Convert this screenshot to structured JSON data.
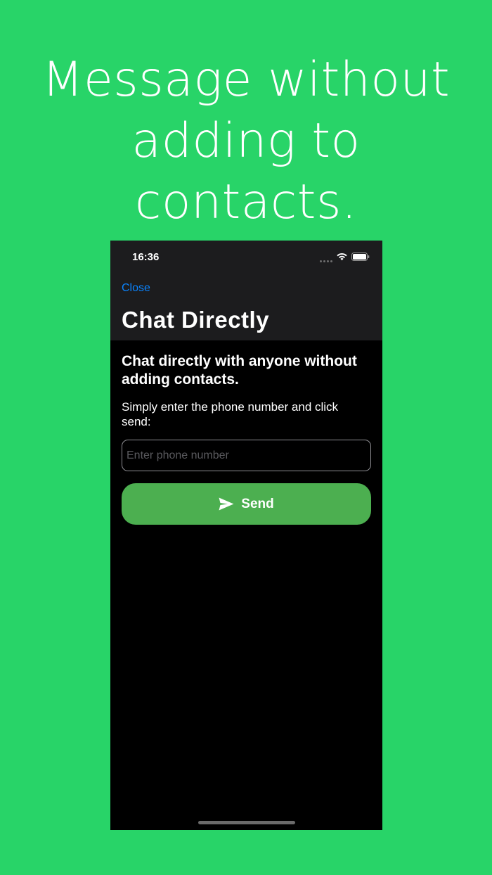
{
  "promo": {
    "headline_lines": [
      "Message without",
      "adding to",
      "contacts."
    ]
  },
  "status_bar": {
    "time": "16:36",
    "icons": [
      "cellular-dots-icon",
      "wifi-icon",
      "battery-icon"
    ]
  },
  "nav": {
    "close_label": "Close",
    "title": "Chat Directly"
  },
  "content": {
    "heading": "Chat directly with anyone without adding contacts.",
    "description": "Simply enter the phone number and click send:"
  },
  "phone_field": {
    "value": "",
    "placeholder": "Enter phone number"
  },
  "send_button": {
    "label": "Send",
    "icon": "paper-plane-icon"
  },
  "colors": {
    "background": "#28d468",
    "nav_background": "#1c1c1e",
    "accent_link": "#0a84ff",
    "button": "#4caf50"
  }
}
